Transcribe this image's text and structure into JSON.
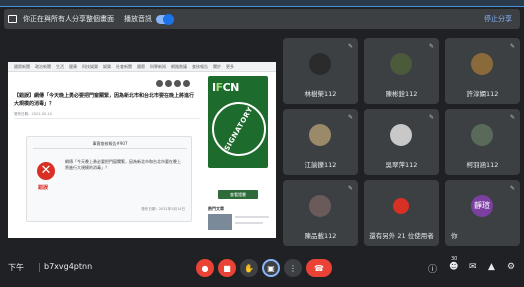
{
  "share_bar": {
    "message": "你正在與所有人分享整個畫面",
    "option_label": "播放音訊",
    "stop_label": "停止分享"
  },
  "shared_screen": {
    "nav_items": [
      "國際新聞",
      "政治新聞",
      "生活",
      "健康",
      "科技娛樂",
      "娛樂",
      "社會新聞",
      "國際",
      "科學新知",
      "網路熱議",
      "查核報告",
      "關於",
      "更多"
    ],
    "headline": "【錯誤】網傳「今天晚上勇必要把門窗關緊，因為新北市和台北市要在晚上將進行大規模的消毒」？",
    "date": "發布日期：2021-05-14",
    "card": {
      "title": "事實查核報告#907",
      "verdict": "錯誤",
      "body": "網傳「今天晚上勇必要把門窗關緊，因為新北市和台北市要在晚上將進行大規模的消毒」？",
      "meta": "發布日期：2021年5月14日"
    },
    "badge": {
      "logo_prefix": "I",
      "logo_mid": "F",
      "logo_suffix": "CN",
      "seal_text": "SIGNATORY",
      "button_label": "查看證書",
      "related_title": "熱門文章"
    }
  },
  "participants": [
    {
      "name": "林樹榮112",
      "avatar_color": "#2b2b2b"
    },
    {
      "name": "陳彬銓112",
      "avatar_color": "#4a5a3a"
    },
    {
      "name": "許淳嫻112",
      "avatar_color": "#8a6a3a"
    },
    {
      "name": "江諭鑠112",
      "avatar_color": "#9a8a6a"
    },
    {
      "name": "吳翠萍112",
      "avatar_color": "#c8c8c8"
    },
    {
      "name": "柯羽涵112",
      "avatar_color": "#5a6a5a"
    },
    {
      "name": "陳品載112",
      "avatar_color": "#6a5a5a"
    },
    {
      "name": "還有另外 21 位使用者",
      "avatar_color": "#d93025"
    },
    {
      "name": "你",
      "avatar_label": "靜瑄",
      "avatar_color": "#7b3fa0"
    }
  ],
  "bottom_bar": {
    "time": "下午",
    "meeting_code": "b7xvg4ptnn",
    "participant_count": "30"
  },
  "colors": {
    "background": "#202124",
    "tile": "#3c4043",
    "accent_blue": "#8ab4f8",
    "danger_red": "#ea4335"
  },
  "icons": [
    "screen-share-icon",
    "mic-off-icon",
    "camera-off-icon",
    "raise-hand-icon",
    "present-icon",
    "more-icon",
    "end-call-icon",
    "info-icon",
    "people-icon",
    "chat-icon",
    "activities-icon",
    "host-controls-icon"
  ]
}
